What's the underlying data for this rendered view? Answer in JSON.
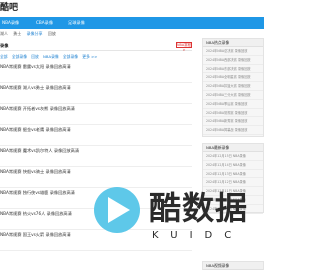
{
  "header": {
    "logo": "酷吧"
  },
  "nav": {
    "items": [
      "NBA录像",
      "CBA录像",
      "足球录像"
    ]
  },
  "subnav": {
    "items": [
      "湖人",
      "勇士",
      "录像分享",
      "回放"
    ],
    "active_index": 2
  },
  "list": {
    "section_label": "录像",
    "feedback_label": "NBA赛程 >",
    "tags": [
      "全部",
      "全部录像",
      "回放",
      "NBA录像",
      "全部录像",
      "更多 >>"
    ],
    "items": [
      "NBA常规赛 雷霆vs太阳 录像回放高清",
      "NBA常规赛 湖人vs勇士 录像回放高清",
      "NBA常规赛 开拓者vs灰熊 录像回放高清",
      "NBA常规赛 掘金vs老鹰 录像回放高清",
      "NBA常规赛 魔术vs凯尔特人 录像回放高清",
      "NBA常规赛 快船vs骑士 录像回放高清",
      "NBA常规赛 独行侠vs雄鹿 录像回放高清",
      "NBA常规赛 热火vs76人 录像回放高清",
      "NBA常规赛 国王vs火箭 录像回放高清"
    ]
  },
  "sidebar": {
    "box1": {
      "title": "NBA热点录像",
      "items": [
        "2024年NBA总决赛 录像回放",
        "2024年NBA西部决赛 录像回放",
        "2024年NBA东部决赛 录像回放",
        "2024年NBA全明星赛 录像回放",
        "2024年NBA扣篮大赛 录像回放",
        "2024年NBA三分大赛 录像回放",
        "2024年NBA季后赛 录像回放",
        "2024年NBA常规赛 录像回放",
        "2024年NBA新秀赛 录像回放",
        "2024年NBA揭幕战 录像回放"
      ]
    },
    "box2": {
      "title": "NBA最新录像",
      "items": [
        "2024年12月15日 NBA录像",
        "2024年12月14日 NBA录像",
        "2024年12月13日 NBA录像",
        "2024年12月12日 NBA录像",
        "2024年12月11日 NBA录像",
        "2024年12月10日 NBA录像",
        "2024年12月09日 NBA录像"
      ]
    },
    "box3": {
      "title": "NBA视频录像"
    }
  },
  "watermark": {
    "brand": "酷数据",
    "sub": "KUIDC"
  }
}
